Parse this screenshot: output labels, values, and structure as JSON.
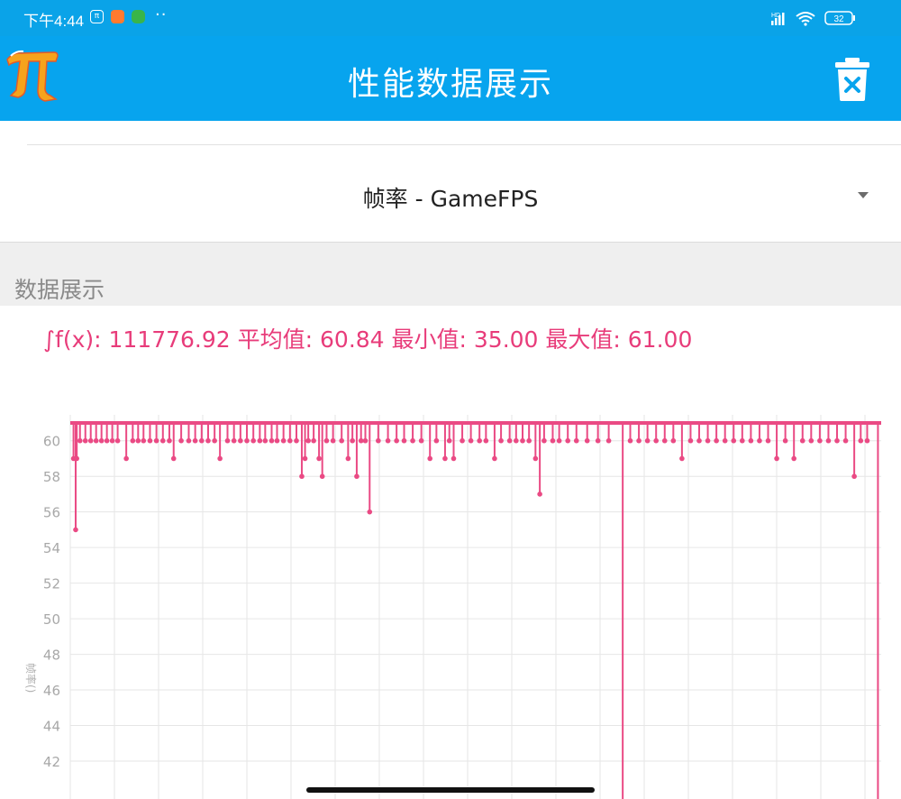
{
  "status_bar": {
    "time": "下午4:44",
    "battery": "32",
    "network": "HD"
  },
  "app_bar": {
    "title": "性能数据展示",
    "logo_icon": "pi-logo-icon",
    "delete_icon": "trash-icon"
  },
  "selector": {
    "value": "帧率 - GameFPS"
  },
  "section": {
    "label": "数据展示"
  },
  "stats": {
    "text": "∫f(x): 111776.92 平均值: 60.84 最小值: 35.00 最大值: 61.00"
  },
  "colors": {
    "app_bar": "#07a4ee",
    "accent": "#e83c7a",
    "series": "#ea4a84",
    "grid": "#e6e6e6"
  },
  "chart_data": {
    "type": "line",
    "ylabel": "帧率()",
    "xlabel": "",
    "ylim": [
      41,
      61
    ],
    "y_ticks": [
      "42",
      "44",
      "46",
      "48",
      "50",
      "52",
      "54",
      "56",
      "58",
      "60"
    ],
    "grid": true,
    "baseline": 61,
    "dips": [
      {
        "x": 0.3,
        "y": 59
      },
      {
        "x": 0.6,
        "y": 59
      },
      {
        "x": 0.9,
        "y": 60
      },
      {
        "x": 1.4,
        "y": 60
      },
      {
        "x": 1.9,
        "y": 60
      },
      {
        "x": 0.5,
        "y": 55
      },
      {
        "x": 2.4,
        "y": 60
      },
      {
        "x": 2.9,
        "y": 60
      },
      {
        "x": 3.4,
        "y": 60
      },
      {
        "x": 3.9,
        "y": 60
      },
      {
        "x": 4.4,
        "y": 60
      },
      {
        "x": 5.2,
        "y": 59
      },
      {
        "x": 5.8,
        "y": 60
      },
      {
        "x": 6.3,
        "y": 60
      },
      {
        "x": 6.8,
        "y": 60
      },
      {
        "x": 7.4,
        "y": 60
      },
      {
        "x": 8.0,
        "y": 60
      },
      {
        "x": 8.6,
        "y": 60
      },
      {
        "x": 9.2,
        "y": 60
      },
      {
        "x": 9.6,
        "y": 59
      },
      {
        "x": 10.3,
        "y": 60
      },
      {
        "x": 11.0,
        "y": 60
      },
      {
        "x": 11.6,
        "y": 60
      },
      {
        "x": 12.2,
        "y": 60
      },
      {
        "x": 12.8,
        "y": 60
      },
      {
        "x": 13.4,
        "y": 60
      },
      {
        "x": 13.9,
        "y": 59
      },
      {
        "x": 14.6,
        "y": 60
      },
      {
        "x": 15.2,
        "y": 60
      },
      {
        "x": 15.8,
        "y": 60
      },
      {
        "x": 16.4,
        "y": 60
      },
      {
        "x": 17.0,
        "y": 60
      },
      {
        "x": 17.6,
        "y": 60
      },
      {
        "x": 18.1,
        "y": 60
      },
      {
        "x": 18.7,
        "y": 60
      },
      {
        "x": 19.2,
        "y": 60
      },
      {
        "x": 19.8,
        "y": 60
      },
      {
        "x": 20.4,
        "y": 60
      },
      {
        "x": 21.0,
        "y": 60
      },
      {
        "x": 21.5,
        "y": 58
      },
      {
        "x": 21.8,
        "y": 59
      },
      {
        "x": 22.1,
        "y": 60
      },
      {
        "x": 22.6,
        "y": 60
      },
      {
        "x": 23.1,
        "y": 59
      },
      {
        "x": 23.4,
        "y": 58
      },
      {
        "x": 23.8,
        "y": 60
      },
      {
        "x": 24.4,
        "y": 60
      },
      {
        "x": 25.2,
        "y": 60
      },
      {
        "x": 25.8,
        "y": 59
      },
      {
        "x": 26.2,
        "y": 60
      },
      {
        "x": 26.6,
        "y": 58
      },
      {
        "x": 27.0,
        "y": 60
      },
      {
        "x": 27.4,
        "y": 60
      },
      {
        "x": 27.8,
        "y": 56
      },
      {
        "x": 28.6,
        "y": 60
      },
      {
        "x": 29.5,
        "y": 60
      },
      {
        "x": 30.3,
        "y": 60
      },
      {
        "x": 31.0,
        "y": 60
      },
      {
        "x": 31.8,
        "y": 60
      },
      {
        "x": 32.6,
        "y": 60
      },
      {
        "x": 33.4,
        "y": 59
      },
      {
        "x": 34.0,
        "y": 60
      },
      {
        "x": 34.8,
        "y": 59
      },
      {
        "x": 35.2,
        "y": 60
      },
      {
        "x": 35.6,
        "y": 59
      },
      {
        "x": 36.4,
        "y": 60
      },
      {
        "x": 37.2,
        "y": 60
      },
      {
        "x": 38.0,
        "y": 60
      },
      {
        "x": 38.6,
        "y": 60
      },
      {
        "x": 39.4,
        "y": 59
      },
      {
        "x": 40.0,
        "y": 60
      },
      {
        "x": 40.8,
        "y": 60
      },
      {
        "x": 41.4,
        "y": 60
      },
      {
        "x": 42.0,
        "y": 60
      },
      {
        "x": 42.6,
        "y": 60
      },
      {
        "x": 43.2,
        "y": 59
      },
      {
        "x": 43.6,
        "y": 57
      },
      {
        "x": 44.0,
        "y": 60
      },
      {
        "x": 44.8,
        "y": 60
      },
      {
        "x": 45.4,
        "y": 60
      },
      {
        "x": 46.2,
        "y": 60
      },
      {
        "x": 47.0,
        "y": 60
      },
      {
        "x": 48.0,
        "y": 60
      },
      {
        "x": 49.0,
        "y": 60
      },
      {
        "x": 50.0,
        "y": 60
      },
      {
        "x": 51.3,
        "y": 35
      },
      {
        "x": 52.0,
        "y": 60
      },
      {
        "x": 52.8,
        "y": 60
      },
      {
        "x": 53.6,
        "y": 60
      },
      {
        "x": 54.4,
        "y": 60
      },
      {
        "x": 55.2,
        "y": 60
      },
      {
        "x": 56.0,
        "y": 60
      },
      {
        "x": 56.8,
        "y": 59
      },
      {
        "x": 57.6,
        "y": 60
      },
      {
        "x": 58.4,
        "y": 60
      },
      {
        "x": 59.2,
        "y": 60
      },
      {
        "x": 60.0,
        "y": 60
      },
      {
        "x": 60.8,
        "y": 60
      },
      {
        "x": 61.6,
        "y": 60
      },
      {
        "x": 62.4,
        "y": 60
      },
      {
        "x": 63.2,
        "y": 60
      },
      {
        "x": 64.0,
        "y": 60
      },
      {
        "x": 64.8,
        "y": 60
      },
      {
        "x": 65.6,
        "y": 59
      },
      {
        "x": 66.4,
        "y": 60
      },
      {
        "x": 67.2,
        "y": 59
      },
      {
        "x": 68.0,
        "y": 60
      },
      {
        "x": 68.8,
        "y": 60
      },
      {
        "x": 69.6,
        "y": 60
      },
      {
        "x": 70.4,
        "y": 60
      },
      {
        "x": 71.2,
        "y": 60
      },
      {
        "x": 72.0,
        "y": 60
      },
      {
        "x": 72.8,
        "y": 58
      },
      {
        "x": 73.4,
        "y": 60
      },
      {
        "x": 74.0,
        "y": 60
      },
      {
        "x": 75.0,
        "y": 35
      }
    ],
    "x_range": [
      0,
      75.3
    ]
  }
}
